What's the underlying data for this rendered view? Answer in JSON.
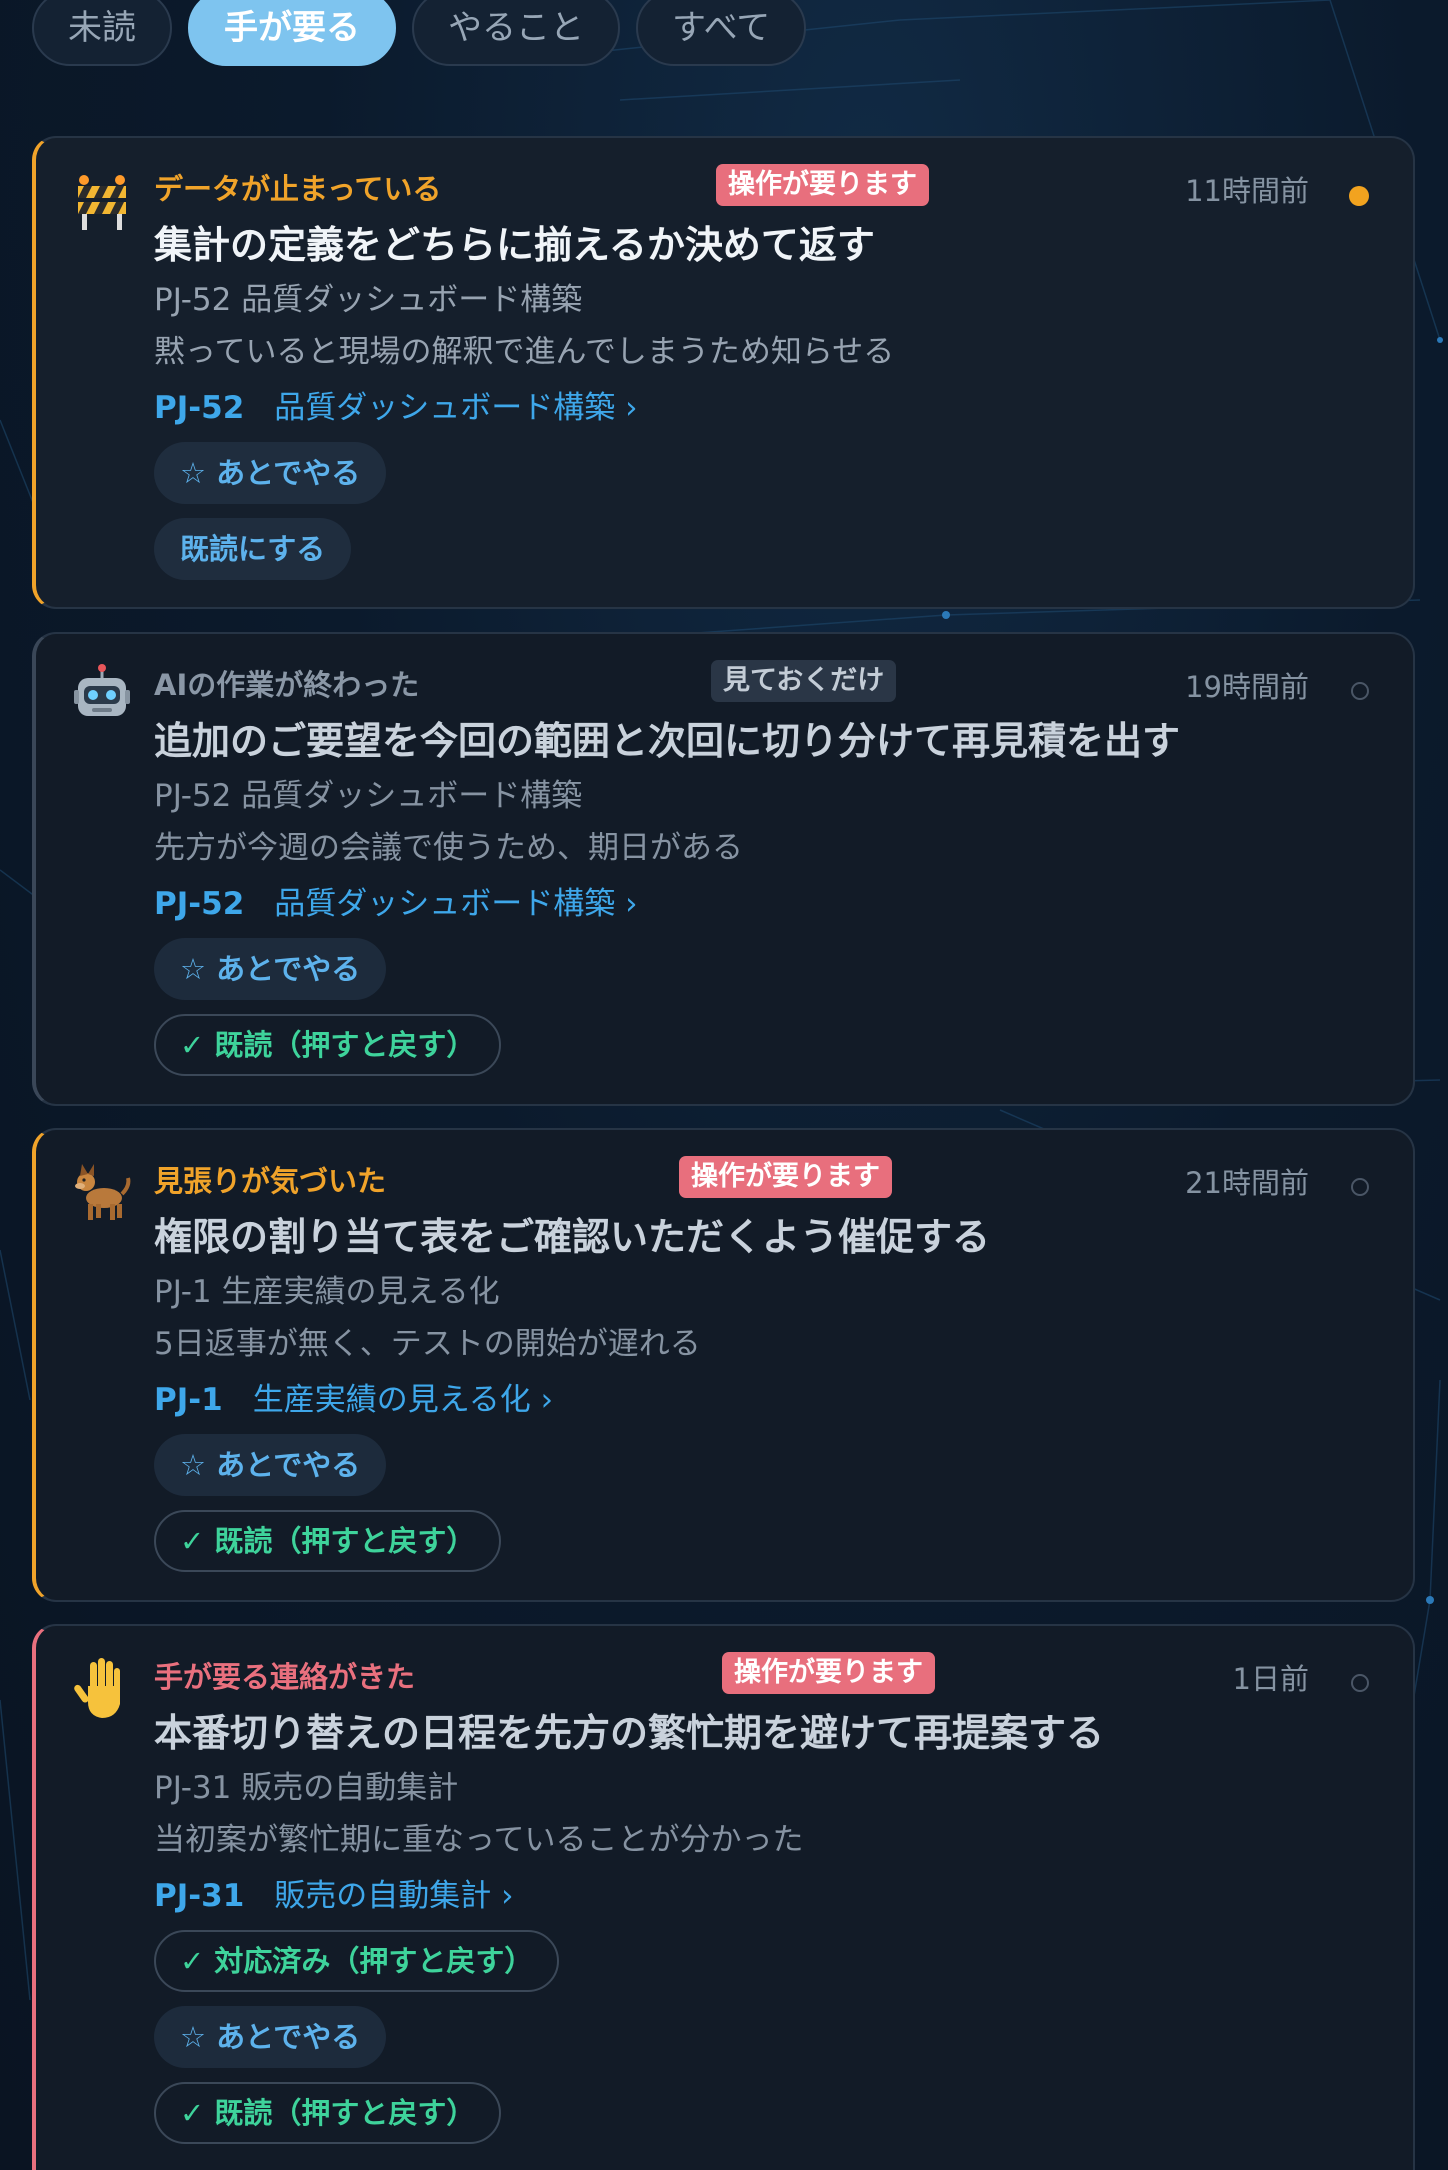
{
  "tabs": [
    {
      "label": "未読",
      "active": false
    },
    {
      "label": "手が要る",
      "active": true
    },
    {
      "label": "やること",
      "active": false
    },
    {
      "label": "すべて",
      "active": false
    }
  ],
  "colors": {
    "accent_orange": "#f0a32a",
    "accent_pink": "#e9707e",
    "link_blue": "#3ea7ea",
    "done_green": "#3ed39b",
    "badge_action": "#e86f7d"
  },
  "cards": [
    {
      "icon": "roadblock-icon",
      "category": "データが止まっている",
      "category_color": "#f0a32a",
      "badge": "操作が要ります",
      "time": "11時間前",
      "unread": true,
      "title": "集計の定義をどちらに揃えるか決めて返す",
      "project_line": "PJ-52 品質ダッシュボード構築",
      "reason": "黙っていると現場の解釈で進んでしまうため知らせる",
      "pj_code": "PJ-52",
      "pj_link": "品質ダッシュボード構築 ›",
      "later_label": "☆ あとでやる",
      "read_label": "既読にする"
    },
    {
      "icon": "robot-icon",
      "category": "AIの作業が終わった",
      "category_color": "#8a97a6",
      "badge": "見ておくだけ",
      "time": "19時間前",
      "unread": false,
      "title": "追加のご要望を今回の範囲と次回に切り分けて再見積を出す",
      "project_line": "PJ-52 品質ダッシュボード構築",
      "reason": "先方が今週の会議で使うため、期日がある",
      "pj_code": "PJ-52",
      "pj_link": "品質ダッシュボード構築 ›",
      "later_label": "☆ あとでやる",
      "read_label": "✓ 既読（押すと戻す）"
    },
    {
      "icon": "dog-icon",
      "category": "見張りが気づいた",
      "category_color": "#f0a32a",
      "badge": "操作が要ります",
      "time": "21時間前",
      "unread": false,
      "title": "権限の割り当て表をご確認いただくよう催促する",
      "project_line": "PJ-1 生産実績の見える化",
      "reason": "5日返事が無く、テストの開始が遅れる",
      "pj_code": "PJ-1",
      "pj_link": "生産実績の見える化 ›",
      "later_label": "☆ あとでやる",
      "read_label": "✓ 既読（押すと戻す）"
    },
    {
      "icon": "raised-hand-icon",
      "category": "手が要る連絡がきた",
      "category_color": "#e9707e",
      "badge": "操作が要ります",
      "time": "1日前",
      "unread": false,
      "title": "本番切り替えの日程を先方の繁忙期を避けて再提案する",
      "project_line": "PJ-31 販売の自動集計",
      "reason": "当初案が繁忙期に重なっていることが分かった",
      "pj_code": "PJ-31",
      "pj_link": "販売の自動集計 ›",
      "done_label": "✓ 対応済み（押すと戻す）",
      "later_label": "☆ あとでやる",
      "read_label": "✓ 既読（押すと戻す）"
    }
  ]
}
